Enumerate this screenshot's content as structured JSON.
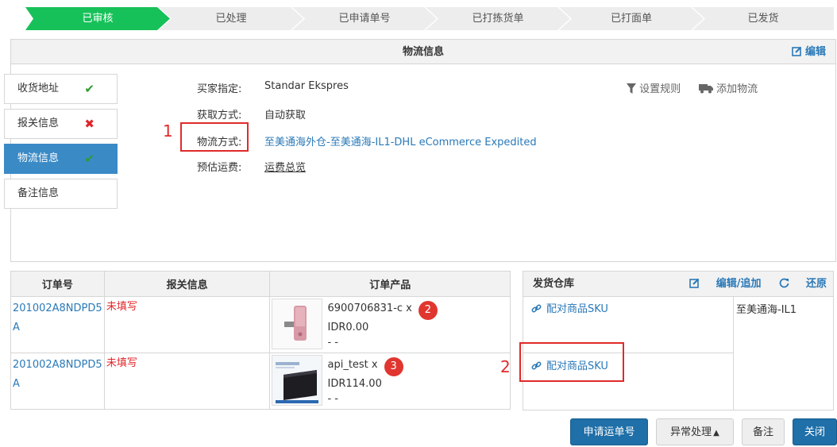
{
  "steps": [
    "已审核",
    "已处理",
    "已申请单号",
    "已打拣货单",
    "已打面单",
    "已发货"
  ],
  "logistics": {
    "title": "物流信息",
    "edit_label": "编辑",
    "tabs": [
      {
        "label": "收货地址",
        "status": "ok"
      },
      {
        "label": "报关信息",
        "status": "error"
      },
      {
        "label": "物流信息",
        "status": "ok"
      },
      {
        "label": "备注信息",
        "status": ""
      }
    ],
    "fields": {
      "buyer_label": "买家指定:",
      "buyer_value": "Standar Ekspres",
      "method_label": "获取方式:",
      "method_value": "自动获取",
      "shipping_label": "物流方式:",
      "shipping_value": "至美通海外仓-至美通海-IL1-DHL eCommerce Expedited",
      "fee_label": "预估运费:",
      "fee_value": "运费总览"
    },
    "tools": {
      "rules": "设置规则",
      "add": "添加物流"
    }
  },
  "annotations": {
    "n1": "1",
    "n2": "2"
  },
  "orders": {
    "headers": [
      "订单号",
      "报关信息",
      "订单产品"
    ],
    "rows": [
      {
        "order_no": "201002A8NDPD5A",
        "customs": "未填写",
        "sku": "6900706831-c x",
        "badge": "2",
        "price": "IDR0.00",
        "extra": "- -"
      },
      {
        "order_no": "201002A8NDPD5A",
        "customs": "未填写",
        "sku": "api_test x",
        "badge": "3",
        "price": "IDR114.00",
        "extra": "- -"
      }
    ]
  },
  "warehouse": {
    "title": "发货仓库",
    "edit_add": "编辑/追加",
    "restore": "还原",
    "pair_label": "配对商品SKU",
    "name": "至美通海-IL1"
  },
  "buttons": {
    "apply": "申请运单号",
    "exception": "异常处理",
    "note": "备注",
    "close": "关闭"
  },
  "colors": {
    "active_step": "#17c159",
    "accent": "#2a79b8",
    "error": "#e0262a"
  }
}
